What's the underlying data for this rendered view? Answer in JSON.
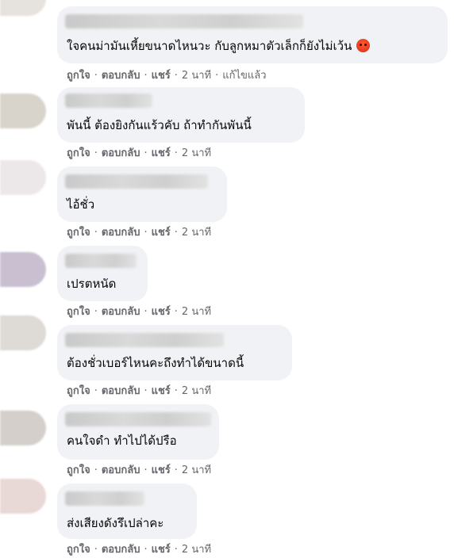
{
  "actions": {
    "like": "ถูกใจ",
    "reply": "ตอบกลับ",
    "share": "แชร์",
    "separator": "·",
    "edited": "แก้ไขแล้ว"
  },
  "comments": [
    {
      "text": "ใจคนม่ามันเหี้ยขนาดไหนวะ กับลูกหมาตัวเล็กก็ยังไม่เว้น",
      "time": "2 นาที"
    },
    {
      "text": "พันนี้ ต้องยิงกันแร้วคับ ถ้าทำกันพันนี้",
      "time": "2 นาที"
    },
    {
      "text": "ไอ้ชั่ว",
      "time": "2 นาที"
    },
    {
      "text": "เปรตหนัด",
      "time": "2 นาที"
    },
    {
      "text": "ต้องชั่วเบอร์ไหนคะถึงทำได้ขนาดนี้",
      "time": "2 นาที"
    },
    {
      "text": "คนใจดำ ทำไปได้ปรือ",
      "time": "2 นาที"
    },
    {
      "text": "ส่งเสียงดังรึเปล่าคะ",
      "time": "2 นาที"
    }
  ],
  "colors": {
    "bubble": "#f0f2f5",
    "meta_text": "#65676b",
    "body_text": "#050505"
  },
  "icons": {
    "reaction": "angry-face-emoji"
  }
}
